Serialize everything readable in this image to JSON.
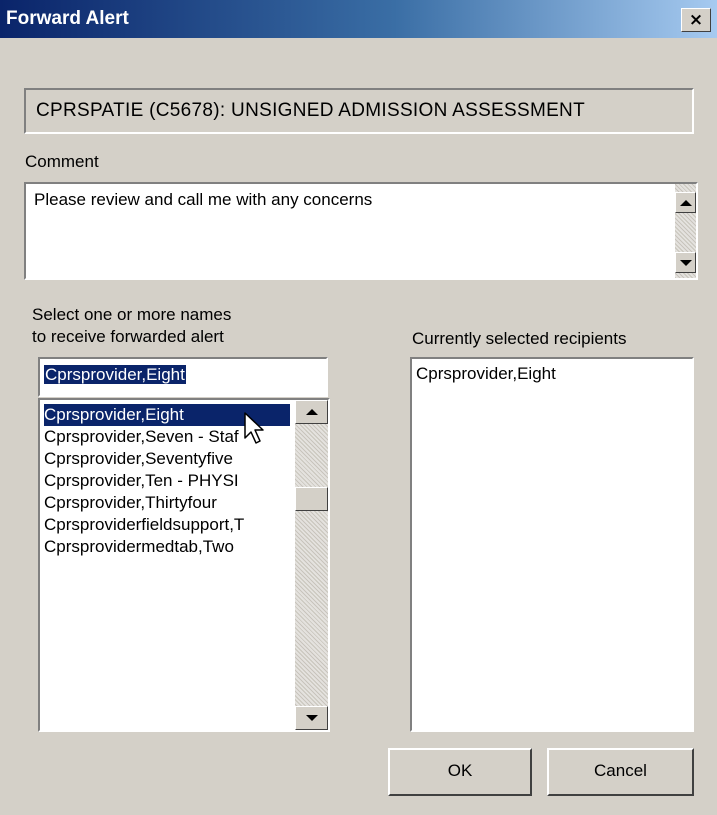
{
  "window": {
    "title": "Forward Alert",
    "close_label": "×"
  },
  "alert": {
    "subject": "CPRSPATIE (C5678): UNSIGNED ADMISSION ASSESSMENT"
  },
  "comment": {
    "label": "Comment",
    "value": "Please review and call me with any concerns"
  },
  "names": {
    "instruction_line1": "Select one or more names",
    "instruction_line2": "to receive forwarded alert",
    "search_value": "Cprsprovider,Eight",
    "items": [
      {
        "label": "Cprsprovider,Eight"
      },
      {
        "label": "Cprsprovider,Seven - Staf"
      },
      {
        "label": "Cprsprovider,Seventyfive"
      },
      {
        "label": "Cprsprovider,Ten - PHYSI"
      },
      {
        "label": "Cprsprovider,Thirtyfour"
      },
      {
        "label": "Cprsproviderfieldsupport,T"
      },
      {
        "label": "Cprsprovidermedtab,Two"
      }
    ],
    "selected_index": 0
  },
  "recipients": {
    "label": "Currently selected recipients",
    "items": [
      "Cprsprovider,Eight"
    ]
  },
  "buttons": {
    "ok_label": "OK",
    "cancel_label": "Cancel"
  },
  "icons": {
    "cursor": "mouse-pointer-icon",
    "scroll_up": "triangle-up-icon",
    "scroll_down": "triangle-down-icon",
    "close": "close-icon"
  },
  "colors": {
    "titlebar_start": "#0a246a",
    "titlebar_end": "#a6caf0",
    "selection": "#0a246a",
    "dialog_bg": "#d4d0c8"
  }
}
